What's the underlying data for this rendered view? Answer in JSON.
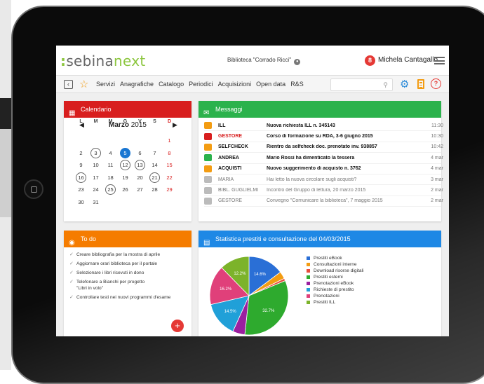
{
  "header": {
    "logo_part1": "sebina",
    "logo_part2": "next",
    "library": "Biblioteca \"Corrado Ricci\"",
    "notification_count": "8",
    "user": "Michela Cantagallo"
  },
  "menu": {
    "items": [
      "Servizi",
      "Anagrafiche",
      "Catalogo",
      "Periodici",
      "Acquisizioni",
      "Open data",
      "R&S"
    ],
    "search_placeholder": ""
  },
  "calendar": {
    "title": "Calendario",
    "month": "Marzo",
    "year": "2015",
    "weekdays": [
      "L",
      "M",
      "M",
      "G",
      "V",
      "S",
      "D"
    ],
    "weeks": [
      [
        "",
        "",
        "",
        "",
        "",
        "",
        "1"
      ],
      [
        "2",
        "3",
        "4",
        "5",
        "6",
        "7",
        "8"
      ],
      [
        "9",
        "10",
        "11",
        "12",
        "13",
        "14",
        "15"
      ],
      [
        "16",
        "17",
        "18",
        "19",
        "20",
        "21",
        "22"
      ],
      [
        "23",
        "24",
        "25",
        "26",
        "27",
        "28",
        "29"
      ],
      [
        "30",
        "31",
        "",
        "",
        "",
        "",
        ""
      ]
    ],
    "circled_days": [
      "3",
      "12",
      "13",
      "16",
      "21",
      "25"
    ],
    "today": "5"
  },
  "messages": {
    "title": "Messaggi",
    "items": [
      {
        "sender": "ILL",
        "text": "Nuova richiesta ILL n. 345143",
        "time": "11:30",
        "icon": "rss-icon",
        "color": "#f39c12",
        "unread": true
      },
      {
        "sender": "GESTORE",
        "text": "Corso di formazione su RDA, 3-6 giugno 2015",
        "time": "10:30",
        "icon": "pin-icon",
        "color": "#d81e1e",
        "unread": true
      },
      {
        "sender": "SELFCHECK",
        "text": "Rientro da selfcheck doc. prenotato inv. 938857",
        "time": "10:42",
        "icon": "rss-icon",
        "color": "#f39c12",
        "unread": true
      },
      {
        "sender": "ANDREA",
        "text": "Mario Rossi ha dimenticato la tessera",
        "time": "4 mar",
        "icon": "mail-icon",
        "color": "#2bb24c",
        "unread": true
      },
      {
        "sender": "ACQUISTI",
        "text": "Nuovo suggerimento di acquisto n. 3762",
        "time": "4 mar",
        "icon": "rss-icon",
        "color": "#f39c12",
        "unread": true
      },
      {
        "sender": "MARIA",
        "text": "Hai letto la nuova circolare sugli acquisti?",
        "time": "3 mar",
        "icon": "mail-icon",
        "color": "#bbbbbb",
        "unread": false
      },
      {
        "sender": "BIBL. GUGLIELMI",
        "text": "Incontro del Gruppo di lettura, 20 marzo 2015",
        "time": "2 mar",
        "icon": "pin-icon",
        "color": "#bbbbbb",
        "unread": false
      },
      {
        "sender": "GESTORE",
        "text": "Convegno \"Comunicare la biblioteca\", 7 maggio 2015",
        "time": "2 mar",
        "icon": "pin-icon",
        "color": "#bbbbbb",
        "unread": false
      }
    ]
  },
  "todo": {
    "title": "To do",
    "items": [
      "Creare bibliografia per la mostra di aprile",
      "Aggiornare orari biblioteca per il portale",
      "Selezionare i libri ricevuti in dono",
      "Telefonare a Bianchi per progetto\n\"Libri in volo\"",
      "Controllare testi nei nuovi programmi d'esame"
    ],
    "add_label": "+"
  },
  "stats": {
    "title": "Statistica prestiti e consultazione del 04/03/2015"
  },
  "chart_data": {
    "type": "pie",
    "title": "Statistica prestiti e consultazione del 04/03/2015",
    "categories": [
      "Prestiti eBook",
      "Consultazioni interne",
      "Download risorse digitali",
      "Prestiti esterni",
      "Prenotazioni eBook",
      "Richieste di prestito",
      "Prenotazioni",
      "Prestiti ILL"
    ],
    "values": [
      14.6,
      3.0,
      1.0,
      32.7,
      5.0,
      14.5,
      16.2,
      12.2
    ],
    "labels": [
      "14.6%",
      "",
      "",
      "32.7%",
      "",
      "14.5%",
      "16.2%",
      "12.2%"
    ],
    "colors": [
      "#2a6fd6",
      "#f39c12",
      "#e74c3c",
      "#2eaa2e",
      "#9b1fa0",
      "#20a0d8",
      "#e0407a",
      "#7cb32a"
    ],
    "legend_position": "right"
  }
}
